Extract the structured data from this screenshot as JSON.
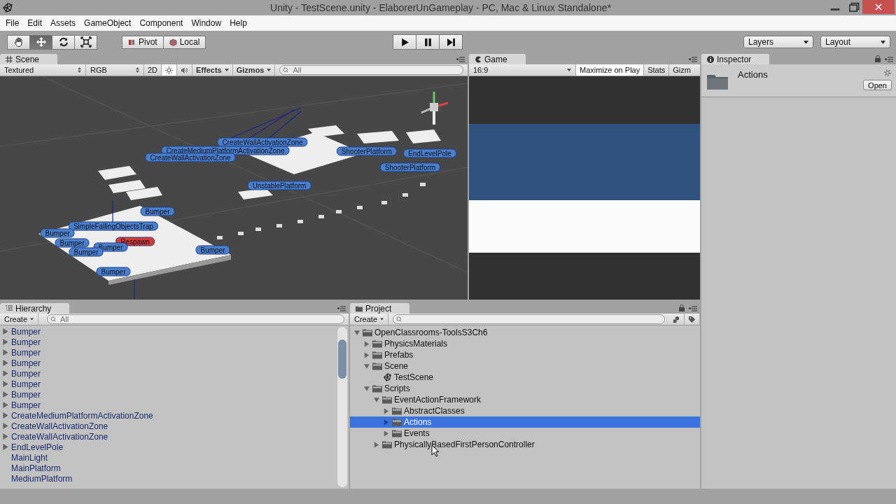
{
  "window": {
    "title": "Unity - TestScene.unity - ElaborerUnGameplay - PC, Mac & Linux Standalone*"
  },
  "menu": [
    "File",
    "Edit",
    "Assets",
    "GameObject",
    "Component",
    "Window",
    "Help"
  ],
  "toolbar": {
    "tools": [
      {
        "kind": "hand",
        "selected": false
      },
      {
        "kind": "move",
        "selected": true
      },
      {
        "kind": "rotate",
        "selected": false
      },
      {
        "kind": "scale",
        "selected": false
      }
    ],
    "pivot": "Pivot",
    "local": "Local",
    "layers": "Layers",
    "layout": "Layout"
  },
  "scene": {
    "tab": "Scene",
    "shading": "Textured",
    "render_mode": "RGB",
    "mode_2d": "2D",
    "lighting_on": true,
    "audio_on": false,
    "effects": "Effects",
    "gizmos": "Gizmos",
    "search_placeholder": "All",
    "labels": [
      {
        "text": "CreateWallActivationZone",
        "color": "#4a7fd0"
      },
      {
        "text": "CreateMediumPlatformActivationZone",
        "color": "#4a7fd0"
      },
      {
        "text": "CreateWallActivationZone",
        "color": "#4a7fd0"
      },
      {
        "text": "ShooterPlatform",
        "color": "#4a7fd0"
      },
      {
        "text": "EndLevelPole",
        "color": "#4a7fd0"
      },
      {
        "text": "ShooterPlatform",
        "color": "#4a7fd0"
      },
      {
        "text": "UnstablePlatform",
        "color": "#4a7fd0"
      },
      {
        "text": "Bumper",
        "color": "#4a7fd0"
      },
      {
        "text": "SimpleFallingObjectsTrap",
        "color": "#4a7fd0"
      },
      {
        "text": "Bumper",
        "color": "#4a7fd0"
      },
      {
        "text": "Respawn",
        "color": "#d63a3a"
      },
      {
        "text": "Bumper",
        "color": "#4a7fd0"
      },
      {
        "text": "Bumper",
        "color": "#4a7fd0"
      },
      {
        "text": "Bumper",
        "color": "#4a7fd0"
      },
      {
        "text": "Bumper",
        "color": "#4a7fd0"
      },
      {
        "text": "Bumper",
        "color": "#4a7fd0"
      }
    ]
  },
  "game": {
    "tab": "Game",
    "aspect": "16:9",
    "maximize_on_play": {
      "label": "Maximize on Play",
      "on": true
    },
    "stats": "Stats",
    "gizmos": "Gizm"
  },
  "inspector": {
    "tab": "Inspector",
    "asset_name": "Actions",
    "open_button": "Open"
  },
  "hierarchy": {
    "tab": "Hierarchy",
    "create": "Create",
    "search_placeholder": "All",
    "items": [
      {
        "name": "Bumper",
        "kind": "group"
      },
      {
        "name": "Bumper",
        "kind": "group"
      },
      {
        "name": "Bumper",
        "kind": "group"
      },
      {
        "name": "Bumper",
        "kind": "group"
      },
      {
        "name": "Bumper",
        "kind": "group"
      },
      {
        "name": "Bumper",
        "kind": "group"
      },
      {
        "name": "Bumper",
        "kind": "group"
      },
      {
        "name": "Bumper",
        "kind": "group"
      },
      {
        "name": "CreateMediumPlatformActivationZone",
        "kind": "group"
      },
      {
        "name": "CreateWallActivationZone",
        "kind": "group"
      },
      {
        "name": "CreateWallActivationZone",
        "kind": "group"
      },
      {
        "name": "EndLevelPole",
        "kind": "group"
      },
      {
        "name": "MainLight",
        "kind": "leaf"
      },
      {
        "name": "MainPlatform",
        "kind": "leaf"
      },
      {
        "name": "MediumPlatform",
        "kind": "leaf"
      }
    ]
  },
  "project": {
    "tab": "Project",
    "create": "Create",
    "tree": [
      {
        "name": "OpenClassrooms-ToolsS3Ch6",
        "kind": "folder",
        "expanded": true,
        "selected": false,
        "children": [
          {
            "name": "PhysicsMaterials",
            "kind": "folder",
            "expanded": false,
            "selected": false
          },
          {
            "name": "Prefabs",
            "kind": "folder",
            "expanded": false,
            "selected": false
          },
          {
            "name": "Scene",
            "kind": "folder",
            "expanded": true,
            "selected": false,
            "children": [
              {
                "name": "TestScene",
                "kind": "scene",
                "selected": false
              }
            ]
          },
          {
            "name": "Scripts",
            "kind": "folder",
            "expanded": true,
            "selected": false,
            "children": [
              {
                "name": "EventActionFramework",
                "kind": "folder",
                "expanded": true,
                "selected": false,
                "children": [
                  {
                    "name": "AbstractClasses",
                    "kind": "folder",
                    "expanded": false,
                    "selected": false
                  },
                  {
                    "name": "Actions",
                    "kind": "folder",
                    "expanded": false,
                    "selected": true
                  },
                  {
                    "name": "Events",
                    "kind": "folder",
                    "expanded": false,
                    "selected": false
                  }
                ]
              },
              {
                "name": "PhysicallyBasedFirstPersonController",
                "kind": "folder",
                "expanded": false,
                "selected": false
              }
            ]
          }
        ]
      }
    ]
  }
}
